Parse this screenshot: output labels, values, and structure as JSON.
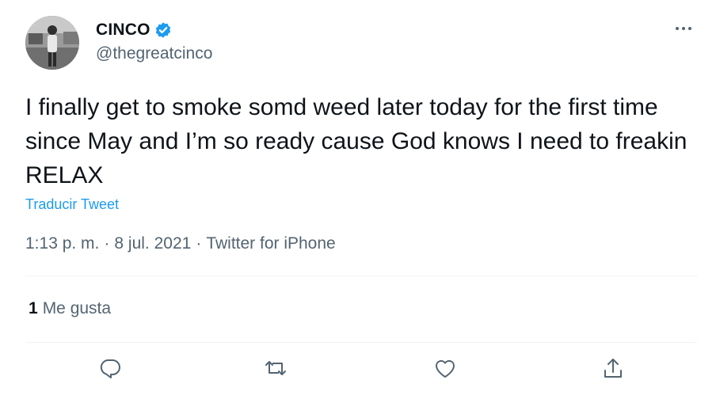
{
  "author": {
    "display_name": "CINCO",
    "handle": "@thegreatcinco",
    "verified": true
  },
  "tweet": {
    "text": "I finally get to smoke somd weed later today for the first time since May and I’m so ready cause God knows I need to freakin RELAX",
    "translate_label": "Traducir Tweet",
    "time": "1:13 p. m.",
    "separator": "·",
    "date": "8 jul. 2021",
    "source": "Twitter for iPhone"
  },
  "stats": {
    "likes_count": "1",
    "likes_label": "Me gusta"
  },
  "actions": {
    "reply_icon": "reply-icon",
    "retweet_icon": "retweet-icon",
    "like_icon": "heart-icon",
    "share_icon": "share-icon",
    "more_icon": "more-icon"
  },
  "colors": {
    "link": "#1d9bf0",
    "verified": "#1d9bf0",
    "secondary_text": "#536471",
    "primary_text": "#0f1419"
  }
}
